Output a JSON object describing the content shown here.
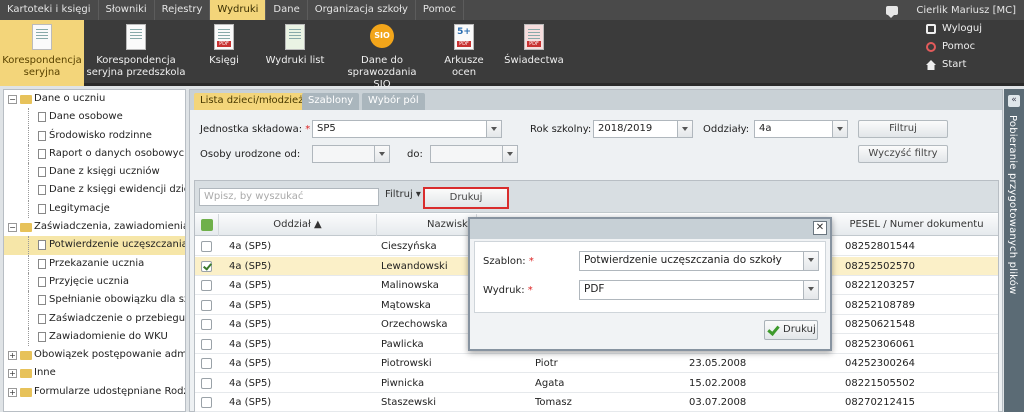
{
  "menubar": {
    "items": [
      "Kartoteki i księgi",
      "Słowniki",
      "Rejestry",
      "Wydruki",
      "Dane",
      "Organizacja szkoły",
      "Pomoc"
    ],
    "active_index": 3,
    "user": "Cierlik Mariusz [MC]"
  },
  "ribbon": {
    "buttons": [
      {
        "label1": "Korespondencja",
        "label2": "seryjna",
        "icon": "document-pointer-icon"
      },
      {
        "label1": "Korespondencja",
        "label2": "seryjna przedszkola",
        "icon": "document-pointer-icon"
      },
      {
        "label1": "Księgi",
        "label2": "",
        "icon": "pdf-icon"
      },
      {
        "label1": "Wydruki list",
        "label2": "",
        "icon": "list-pdf-icon"
      },
      {
        "label1": "Dane do",
        "label2": "sprawozdania SIO",
        "icon": "sio-icon"
      },
      {
        "label1": "Arkusze",
        "label2": "ocen",
        "icon": "pdf-icon"
      },
      {
        "label1": "Świadectwa",
        "label2": "",
        "icon": "pdf-icon"
      }
    ],
    "sio_badge": "SIO",
    "arkusze_badge": "5+",
    "pdf_badge": "PDF",
    "links": [
      "Wyloguj",
      "Pomoc",
      "Start"
    ]
  },
  "tree": {
    "items": [
      {
        "label": "Dane o uczniu",
        "level": 0,
        "expanded": true
      },
      {
        "label": "Dane osobowe",
        "level": 1
      },
      {
        "label": "Środowisko rodzinne",
        "level": 1
      },
      {
        "label": "Raport o danych osobowych",
        "level": 1
      },
      {
        "label": "Dane z księgi uczniów",
        "level": 1
      },
      {
        "label": "Dane z księgi ewidencji dzieci",
        "level": 1
      },
      {
        "label": "Legitymacje",
        "level": 1
      },
      {
        "label": "Zaświadczenia, zawiadomienia",
        "level": 0,
        "expanded": true
      },
      {
        "label": "Potwierdzenie uczęszczania do",
        "level": 1,
        "selected": true
      },
      {
        "label": "Przekazanie ucznia",
        "level": 1
      },
      {
        "label": "Przyjęcie ucznia",
        "level": 1
      },
      {
        "label": "Spełnianie obowiązku dla szkół",
        "level": 1
      },
      {
        "label": "Zaświadczenie o przebiegu nau",
        "level": 1
      },
      {
        "label": "Zawiadomienie do WKU",
        "level": 1
      },
      {
        "label": "Obowiązek postępowanie administ",
        "level": 0,
        "expanded": false
      },
      {
        "label": "Inne",
        "level": 0,
        "expanded": false
      },
      {
        "label": "Formularze udostępniane Rodzicor",
        "level": 0,
        "expanded": false
      }
    ]
  },
  "tabs": [
    "Lista dzieci/młodzieży",
    "Szablony",
    "Wybór pól"
  ],
  "filters": {
    "jednostka_label": "Jednostka składowa:",
    "jednostka_value": "SP5",
    "rok_label": "Rok szkolny:",
    "rok_value": "2018/2019",
    "oddzialy_label": "Oddziały:",
    "oddzialy_value": "4a",
    "filtruj_button": "Filtruj",
    "urodzone_label": "Osoby urodzone od:",
    "do_label": "do:",
    "wyczysc_button": "Wyczyść filtry"
  },
  "grid": {
    "search_placeholder": "Wpisz, by wyszukać",
    "filtruj_dropdown": "Filtruj ▾",
    "drukuj_button": "Drukuj",
    "headers": {
      "oddzial": "Oddział ▲",
      "nazwisko": "Nazwisk",
      "pesel": "PESEL / Numer dokumentu"
    },
    "rows": [
      {
        "oddzial": "4a (SP5)",
        "nazwisko": "Cieszyńska",
        "imie": "",
        "data": "",
        "pesel": "08252801544",
        "checked": false
      },
      {
        "oddzial": "4a (SP5)",
        "nazwisko": "Lewandowski",
        "imie": "",
        "data": "",
        "pesel": "08252502570",
        "checked": true
      },
      {
        "oddzial": "4a (SP5)",
        "nazwisko": "Malinowska",
        "imie": "",
        "data": "",
        "pesel": "08221203257",
        "checked": false
      },
      {
        "oddzial": "4a (SP5)",
        "nazwisko": "Mątowska",
        "imie": "",
        "data": "",
        "pesel": "08252108789",
        "checked": false
      },
      {
        "oddzial": "4a (SP5)",
        "nazwisko": "Orzechowska",
        "imie": "",
        "data": "",
        "pesel": "08250621548",
        "checked": false
      },
      {
        "oddzial": "4a (SP5)",
        "nazwisko": "Pawlicka",
        "imie": "",
        "data": "",
        "pesel": "08252306061",
        "checked": false
      },
      {
        "oddzial": "4a (SP5)",
        "nazwisko": "Piotrowski",
        "imie": "Piotr",
        "data": "23.05.2008",
        "pesel": "04252300264",
        "checked": false
      },
      {
        "oddzial": "4a (SP5)",
        "nazwisko": "Piwnicka",
        "imie": "Agata",
        "data": "15.02.2008",
        "pesel": "08221505502",
        "checked": false
      },
      {
        "oddzial": "4a (SP5)",
        "nazwisko": "Staszewski",
        "imie": "Tomasz",
        "data": "03.07.2008",
        "pesel": "08270212415",
        "checked": false
      }
    ]
  },
  "right_panel": {
    "title": "Pobieranie przygotowanych plików"
  },
  "modal": {
    "szablon_label": "Szablon:",
    "szablon_value": "Potwierdzenie uczęszczania do szkoły",
    "wydruk_label": "Wydruk:",
    "wydruk_value": "PDF",
    "drukuj_button": "Drukuj"
  },
  "colors": {
    "active_tab": "#f3d57a",
    "highlight": "#d92d2d",
    "ribbon_bg": "#3b3b3b"
  }
}
